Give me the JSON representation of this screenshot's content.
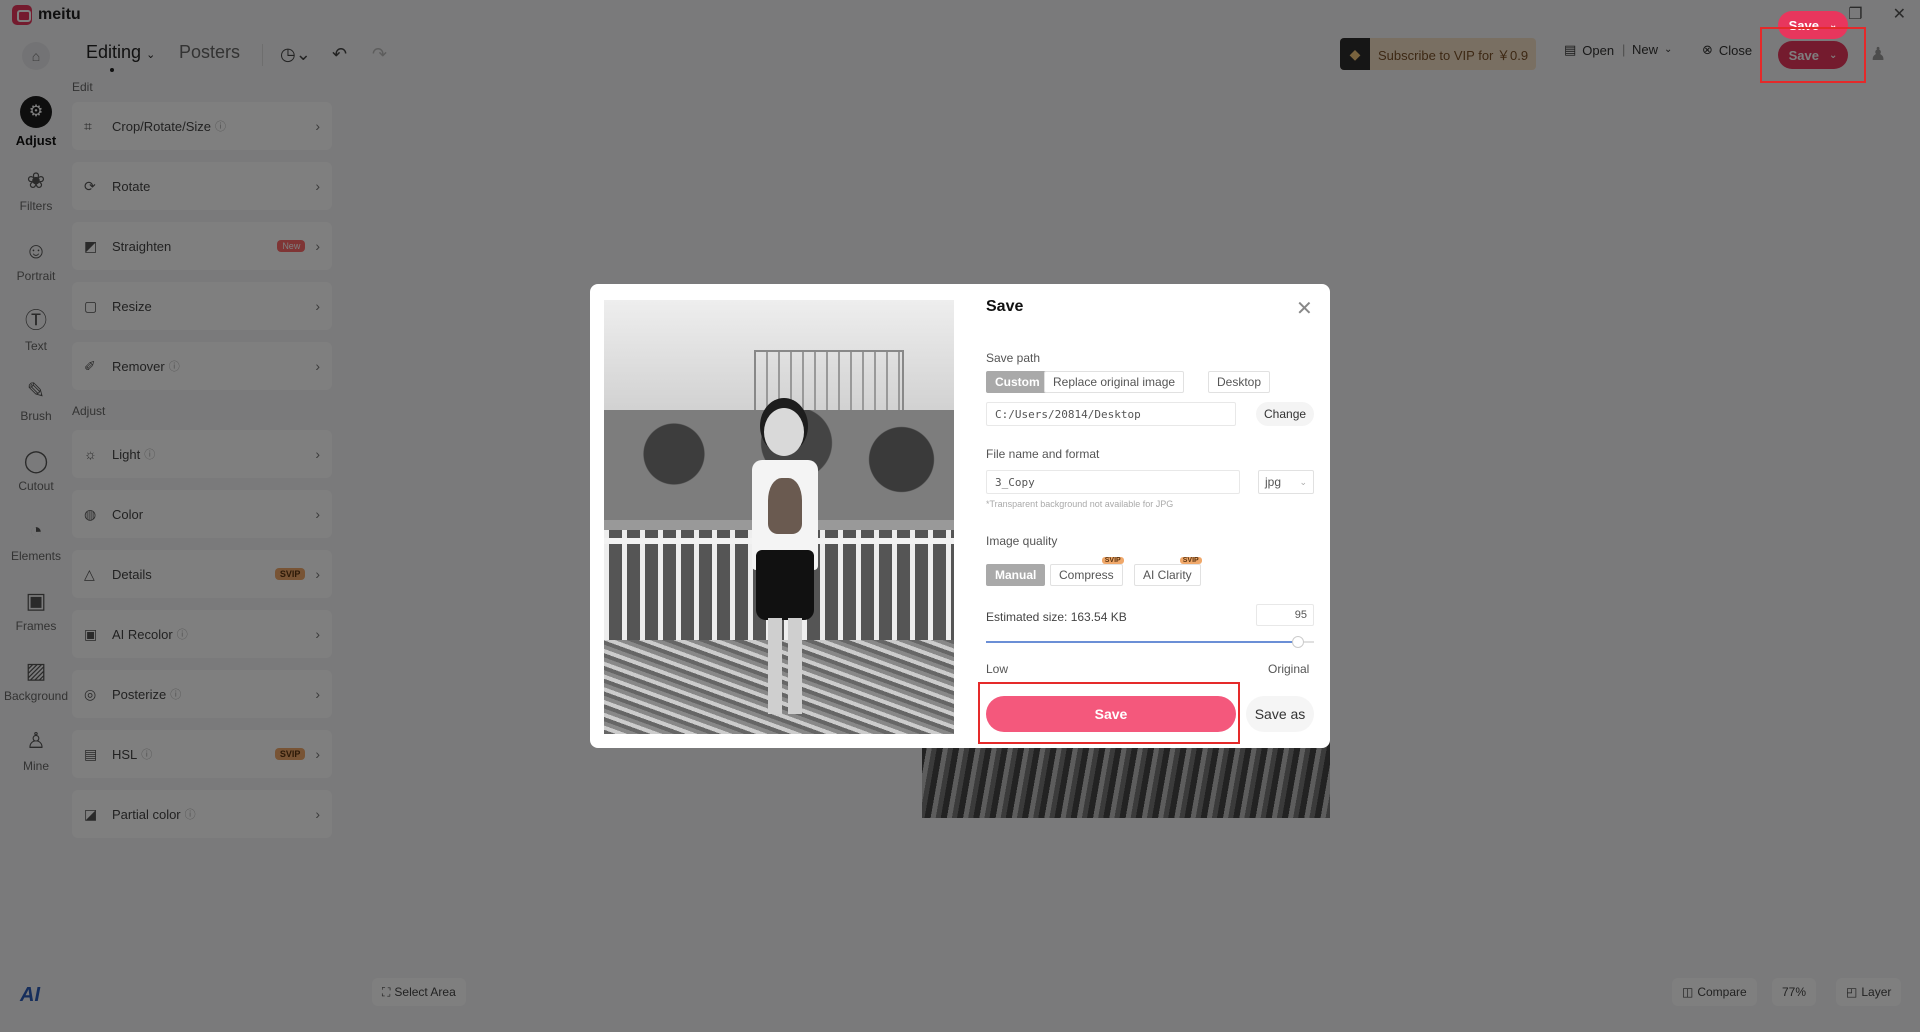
{
  "app": {
    "name": "meitu"
  },
  "window": {
    "minimize": "—",
    "maximize": "❐",
    "close": "✕"
  },
  "toolbar": {
    "mode_editing": "Editing",
    "mode_posters": "Posters",
    "vip_text": "Subscribe to VIP for ￥0.9",
    "open": "Open",
    "new": "New",
    "close": "Close",
    "save": "Save"
  },
  "nav": [
    {
      "label": "Adjust",
      "icon": "adjust-icon",
      "glyph": "⚙",
      "active": true
    },
    {
      "label": "Filters",
      "icon": "filters-icon",
      "glyph": "❀"
    },
    {
      "label": "Portrait",
      "icon": "portrait-icon",
      "glyph": "☺"
    },
    {
      "label": "Text",
      "icon": "text-icon",
      "glyph": "Ⓣ"
    },
    {
      "label": "Brush",
      "icon": "brush-icon",
      "glyph": "✎"
    },
    {
      "label": "Cutout",
      "icon": "cutout-icon",
      "glyph": "◯"
    },
    {
      "label": "Elements",
      "icon": "elements-icon",
      "glyph": "◔"
    },
    {
      "label": "Frames",
      "icon": "frames-icon",
      "glyph": "▣"
    },
    {
      "label": "Background",
      "icon": "background-icon",
      "glyph": "▨"
    },
    {
      "label": "Mine",
      "icon": "mine-icon",
      "glyph": "♙"
    }
  ],
  "panel": {
    "edit_label": "Edit",
    "adjust_label": "Adjust",
    "edit_tools": [
      {
        "label": "Crop/Rotate/Size",
        "icon": "crop-icon",
        "glyph": "⌗",
        "help": true
      },
      {
        "label": "Rotate",
        "icon": "rotate-icon",
        "glyph": "⟳"
      },
      {
        "label": "Straighten",
        "icon": "straighten-icon",
        "glyph": "◩",
        "badge": "New"
      },
      {
        "label": "Resize",
        "icon": "resize-icon",
        "glyph": "▢"
      },
      {
        "label": "Remover",
        "icon": "remover-icon",
        "glyph": "✐",
        "help": true
      }
    ],
    "adjust_tools": [
      {
        "label": "Light",
        "icon": "light-icon",
        "glyph": "☼",
        "help": true
      },
      {
        "label": "Color",
        "icon": "color-icon",
        "glyph": "◍"
      },
      {
        "label": "Details",
        "icon": "details-icon",
        "glyph": "△",
        "badge": "SVIP"
      },
      {
        "label": "AI Recolor",
        "icon": "ai-recolor-icon",
        "glyph": "▣",
        "help": true
      },
      {
        "label": "Posterize",
        "icon": "posterize-icon",
        "glyph": "◎",
        "help": true
      },
      {
        "label": "HSL",
        "icon": "hsl-icon",
        "glyph": "▤",
        "help": true,
        "badge": "SVIP"
      },
      {
        "label": "Partial color",
        "icon": "partial-color-icon",
        "glyph": "◪",
        "help": true
      }
    ]
  },
  "bottom": {
    "select_area": "Select Area",
    "compare": "Compare",
    "zoom": "77%",
    "layer": "Layer"
  },
  "dialog": {
    "title": "Save",
    "save_path_label": "Save path",
    "path_options": [
      "Custom",
      "Replace original image",
      "Desktop"
    ],
    "path_value": "C:/Users/20814/Desktop",
    "change": "Change",
    "file_label": "File name and format",
    "file_name": "3_Copy",
    "format": "jpg",
    "format_hint": "*Transparent background not available for JPG",
    "quality_label": "Image quality",
    "quality_options": [
      "Manual",
      "Compress",
      "AI Clarity"
    ],
    "svip": "SVIP",
    "estimated_size": "Estimated size: 163.54 KB",
    "quality_value": "95",
    "quality_fraction": 0.95,
    "low": "Low",
    "original": "Original",
    "save": "Save",
    "save_as": "Save as"
  }
}
